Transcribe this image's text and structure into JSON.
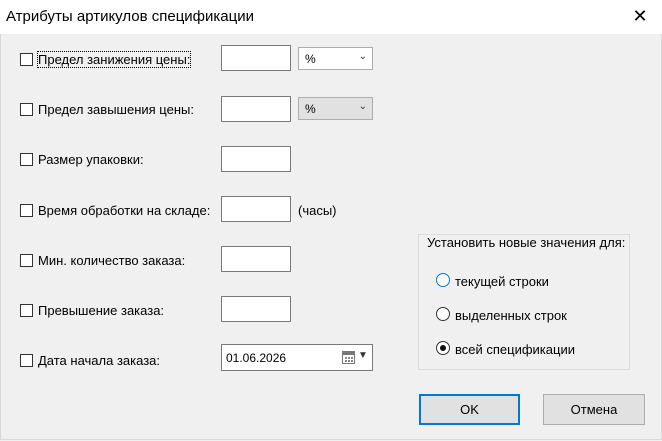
{
  "window": {
    "title": "Атрибуты артикулов спецификации",
    "close_glyph": "✕"
  },
  "rows": {
    "price_lower_limit": {
      "label": "Предел занижения цены:",
      "checked": false,
      "value": "",
      "unit": "%"
    },
    "price_upper_limit": {
      "label": "Предел завышения цены:",
      "checked": false,
      "value": "",
      "unit": "%"
    },
    "package_size": {
      "label": "Размер упаковки:",
      "checked": false,
      "value": ""
    },
    "warehouse_time": {
      "label": "Время обработки на складе:",
      "checked": false,
      "value": "",
      "unit": "(часы)"
    },
    "min_order_qty": {
      "label": "Мин. количество заказа:",
      "checked": false,
      "value": ""
    },
    "order_excess": {
      "label": "Превышение заказа:",
      "checked": false,
      "value": ""
    },
    "order_start_date": {
      "label": "Дата начала заказа:",
      "checked": false,
      "value": "01.06.2026"
    }
  },
  "apply_group": {
    "title": "Установить новые значения для:",
    "options": [
      {
        "label": "текущей строки",
        "selected": false
      },
      {
        "label": "выделенных строк",
        "selected": false
      },
      {
        "label": "всей спецификации",
        "selected": true
      }
    ]
  },
  "buttons": {
    "ok": "OK",
    "cancel": "Отмена"
  },
  "icons": {
    "dropdown": "chevron-down-icon",
    "calendar": "calendar-icon",
    "close": "close-icon"
  },
  "colors": {
    "window_bg": "#f0f0f0",
    "accent": "#0078d7"
  }
}
